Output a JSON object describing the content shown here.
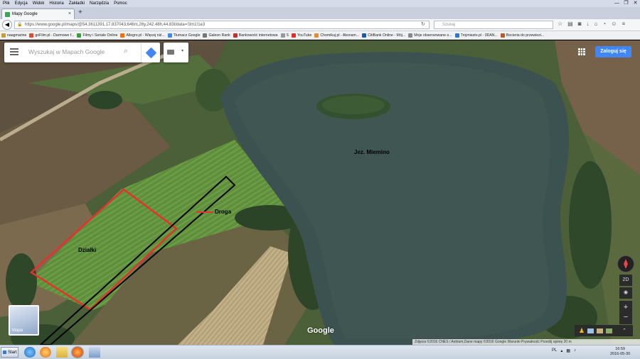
{
  "menu": [
    "Plik",
    "Edycja",
    "Widok",
    "Historia",
    "Zakładki",
    "Narzędzia",
    "Pomoc"
  ],
  "window_controls": [
    "—",
    "❐",
    "✕"
  ],
  "tab": {
    "title": "Mapy Google",
    "close": "×"
  },
  "new_tab": "+",
  "address": {
    "url": "https://www.google.pl/maps/@54.3611391,17.837043,646m,26y,242.48h,44.83t/data=!3m1!1e3"
  },
  "search_box": {
    "placeholder": "Szukaj"
  },
  "bookmarks": [
    {
      "label": "naagmarine",
      "color": "#c8a032"
    },
    {
      "label": "goFilm.pl - Darmowe f...",
      "color": "#e04a2e"
    },
    {
      "label": "Filmy i Seriale Online",
      "color": "#3b9e3b"
    },
    {
      "label": "Allegro.pl - Więcej niż...",
      "color": "#ff6a00"
    },
    {
      "label": "Tłumacz Google",
      "color": "#4285f4"
    },
    {
      "label": "Galeon Rank",
      "color": "#777777"
    },
    {
      "label": "Bankowość internetowa",
      "color": "#c03030"
    },
    {
      "label": "S",
      "color": "#999999"
    },
    {
      "label": "YouTube",
      "color": "#e52d27"
    },
    {
      "label": "Chomikuj.pl - Absnam...",
      "color": "#e88a2e"
    },
    {
      "label": "CitiBank Online - Mój...",
      "color": "#1b5aa8"
    },
    {
      "label": "Moje obserwowane o...",
      "color": "#888888"
    },
    {
      "label": "Trojmiasto.pl - 0DAN...",
      "color": "#2a7ad5"
    },
    {
      "label": "Bocieria do przewiezi...",
      "color": "#c2572a"
    }
  ],
  "maps": {
    "search_placeholder": "Wyszukaj w Mapach Google",
    "signin_label": "Zaloguj się",
    "labels": {
      "lake": "Jez. Miemino",
      "road": "Droga",
      "plots": "Działki"
    },
    "mapa_label": "Mapa",
    "google_logo": "Google",
    "controls": {
      "tilt": "2D",
      "zoom_in": "+",
      "zoom_out": "−",
      "collapse": "⌃"
    },
    "attribution": "Zdjęcia ©2016 CNES / Astrium,Dane mapy ©2016 Google    Warunki    Prywatność    Prześlij opinię    20 m"
  },
  "taskbar": {
    "start_label": "Start",
    "tray_lang": "PL",
    "time": "16:59",
    "date": "2016-05-30"
  },
  "colors": {
    "plot_outline": "#e8302c",
    "road_outline": "#000000",
    "accent": "#4285f4"
  }
}
